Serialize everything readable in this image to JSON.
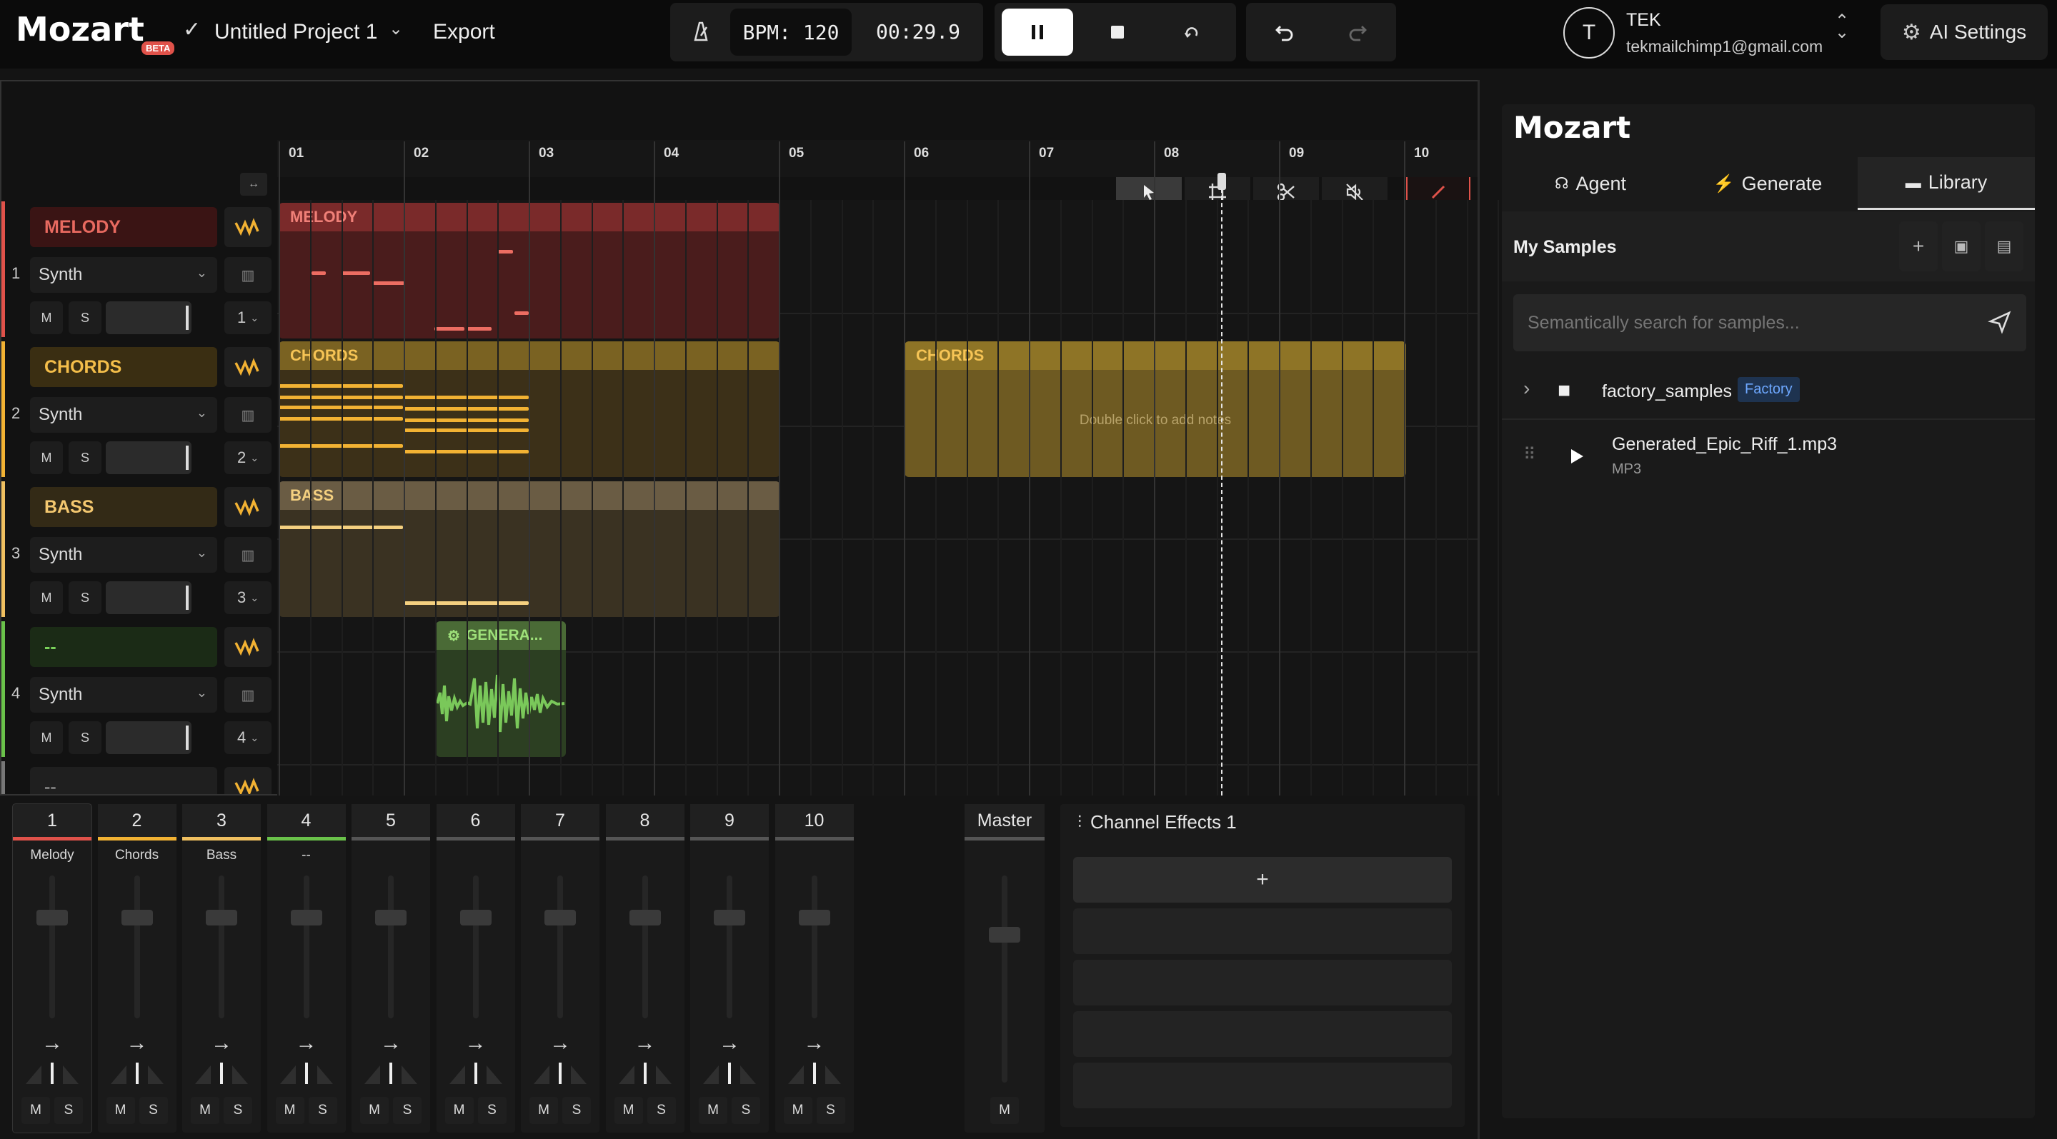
{
  "app": {
    "logo": "Mozart",
    "badge": "BETA",
    "project_title": "Untitled Project 1",
    "export_label": "Export"
  },
  "transport": {
    "bpm_label": "BPM: 120",
    "time": "00:29.9"
  },
  "user": {
    "avatar_initial": "T",
    "name": "TEK",
    "email": "tekmailchimp1@gmail.com"
  },
  "ai_settings_label": "AI Settings",
  "ruler": {
    "bars": [
      "01",
      "02",
      "03",
      "04",
      "05",
      "06",
      "07",
      "08",
      "09",
      "10"
    ]
  },
  "tracks": [
    {
      "number": "1",
      "name": "MELODY",
      "instrument": "Synth",
      "channel": "1",
      "color": "#e0524a",
      "mute": "M",
      "solo": "S"
    },
    {
      "number": "2",
      "name": "CHORDS",
      "instrument": "Synth",
      "channel": "2",
      "color": "#f2b233",
      "mute": "M",
      "solo": "S"
    },
    {
      "number": "3",
      "name": "BASS",
      "instrument": "Synth",
      "channel": "3",
      "color": "#f0c060",
      "mute": "M",
      "solo": "S"
    },
    {
      "number": "4",
      "name": "--",
      "instrument": "Synth",
      "channel": "4",
      "color": "#6ac24a",
      "mute": "M",
      "solo": "S"
    },
    {
      "number": "",
      "name": "--",
      "instrument": "",
      "channel": "",
      "color": "#888888"
    }
  ],
  "clips": {
    "melody": "MELODY",
    "chords_1": "CHORDS",
    "chords_2": "CHORDS",
    "chords_2_hint": "Double click to add notes",
    "bass": "BASS",
    "generated": "GENERA..."
  },
  "mixer": {
    "channels": [
      {
        "num": "1",
        "name": "Melody",
        "color": "#e0524a"
      },
      {
        "num": "2",
        "name": "Chords",
        "color": "#f2b233"
      },
      {
        "num": "3",
        "name": "Bass",
        "color": "#f0c060"
      },
      {
        "num": "4",
        "name": "--",
        "color": "#6ac24a"
      },
      {
        "num": "5",
        "name": "",
        "color": "#555555"
      },
      {
        "num": "6",
        "name": "",
        "color": "#555555"
      },
      {
        "num": "7",
        "name": "",
        "color": "#555555"
      },
      {
        "num": "8",
        "name": "",
        "color": "#555555"
      },
      {
        "num": "9",
        "name": "",
        "color": "#555555"
      },
      {
        "num": "10",
        "name": "",
        "color": "#555555"
      }
    ],
    "mute_label": "M",
    "solo_label": "S",
    "master_label": "Master",
    "effects_title": "Channel Effects 1",
    "add_effect": "+"
  },
  "panel": {
    "logo": "Mozart",
    "tabs": [
      "Agent",
      "Generate",
      "Library"
    ],
    "active_tab": "Library",
    "section_title": "My Samples",
    "search_placeholder": "Semantically search for samples...",
    "folder": {
      "name": "factory_samples",
      "badge": "Factory"
    },
    "sample": {
      "name": "Generated_Epic_Riff_1.mp3",
      "type": "MP3"
    }
  }
}
